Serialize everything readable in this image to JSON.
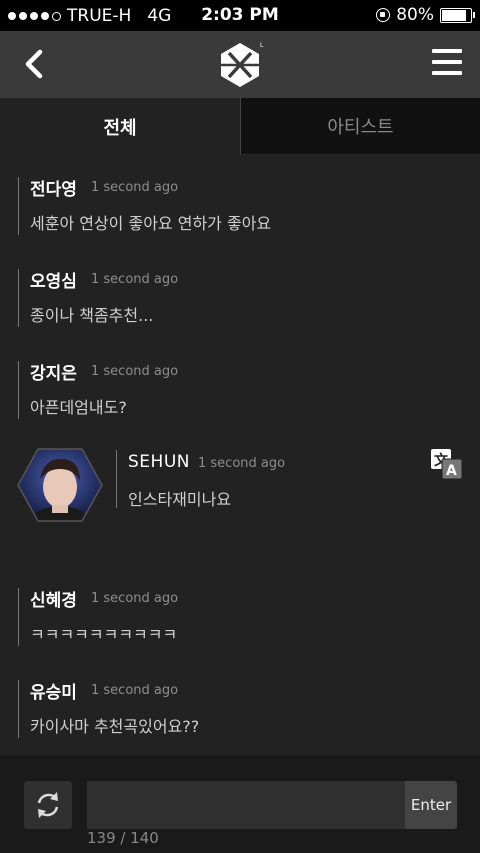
{
  "status_bar": {
    "carrier": "TRUE-H",
    "network": "4G",
    "time": "2:03 PM",
    "battery": "80%",
    "battery_level": 0.8,
    "signal_dots_filled": 4,
    "signal_dots_total": 5
  },
  "header": {
    "back_icon": "chevron-left-icon",
    "logo": "exo-logo",
    "menu_icon": "hamburger-icon"
  },
  "tabs": [
    {
      "label": "전체",
      "active": true
    },
    {
      "label": "아티스트",
      "active": false
    }
  ],
  "messages": [
    {
      "name": "전다영",
      "time": "1 second ago",
      "text": "세훈아 연상이 좋아요 연하가 좋아요"
    },
    {
      "name": "오영심",
      "time": "1 second ago",
      "text": "종이나 책좀추천..."
    },
    {
      "name": "강지은",
      "time": "1 second ago",
      "text": "아픈데엄내도?"
    },
    {
      "name": "신혜경",
      "time": "1 second ago",
      "text": "ㅋㅋㅋㅋㅋㅋㅋㅋㅋㅋ"
    },
    {
      "name": "유승미",
      "time": "1 second ago",
      "text": "카이사마 추천곡있어요??"
    }
  ],
  "artist_message": {
    "name": "SEHUN",
    "time": "1 second ago",
    "text": "인스타재미나요",
    "translate_icon": "translate-icon"
  },
  "composer": {
    "input_value": "",
    "enter_label": "Enter",
    "counter": "139 / 140",
    "refresh_icon": "refresh-icon"
  },
  "colors": {
    "header_bg": "#3a3a3a",
    "feed_bg": "#222222",
    "statusbar_bg": "#000000"
  }
}
